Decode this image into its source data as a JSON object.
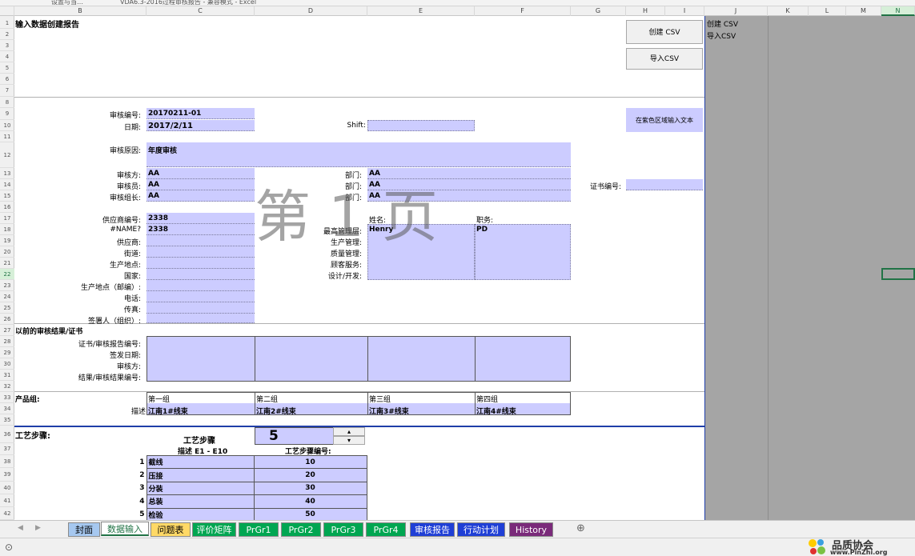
{
  "window": {
    "tab1": "设置与当…",
    "tab2": "VDA6.3-2016过程审核报告 - 兼容模式 - Excel"
  },
  "columns": [
    "B",
    "C",
    "D",
    "E",
    "F",
    "G",
    "H",
    "I",
    "J",
    "K",
    "L",
    "M",
    "N"
  ],
  "rows": [
    "1",
    "2",
    "3",
    "4",
    "5",
    "6",
    "7",
    "8",
    "9",
    "10",
    "11",
    "12",
    "13",
    "14",
    "15",
    "16",
    "17",
    "18",
    "19",
    "20",
    "21",
    "22",
    "23",
    "24",
    "25",
    "26",
    "27",
    "28",
    "29",
    "30",
    "31",
    "32",
    "33",
    "34",
    "35",
    "36",
    "37",
    "38",
    "39",
    "40",
    "41",
    "42"
  ],
  "report": {
    "title": "输入数据创建报告",
    "btn_create_csv": "创建 CSV",
    "btn_import_csv": "导入CSV",
    "note_purple": "在紫色区域输入文本",
    "watermark": "第 1 页"
  },
  "fields": {
    "audit_no_label": "审核编号:",
    "audit_no": "20170211-01",
    "date_label": "日期:",
    "date": "2017/2/11",
    "shift_label": "Shift:",
    "reason_label": "审核原因:",
    "reason": "年度审核",
    "auditee_label": "审核方:",
    "auditee": "AA",
    "auditor_label": "审核员:",
    "auditor": "AA",
    "lead_label": "审核组长:",
    "lead": "AA",
    "dept_label": "部门:",
    "dept1": "AA",
    "dept2": "AA",
    "dept3": "AA",
    "cert_no_label": "证书编号:",
    "supplier_no_label": "供应商编号:",
    "supplier_no": "2338",
    "name_err_label": "#NAME?",
    "name_err_val": "2338",
    "supplier_label": "供应商:",
    "street_label": "街道:",
    "site_label": "生产地点:",
    "country_label": "国家:",
    "postcode_label": "生产地点（邮编）:",
    "phone_label": "电话:",
    "fax_label": "传真:",
    "signer_label": "签署人（组织）:",
    "name_label": "姓名:",
    "position_label": "职务:",
    "mgmt_label": "最高管理层:",
    "mgmt_name": "Henry",
    "mgmt_position": "PD",
    "prod_mgmt_label": "生产管理:",
    "quality_mgmt_label": "质量管理:",
    "customer_service_label": "顾客服务:",
    "design_label": "设计/开发:"
  },
  "previous": {
    "section": "以前的审核结果/证书",
    "cert_report_label": "证书/审核报告编号:",
    "issue_date_label": "签发日期:",
    "auditor_label": "审核方:",
    "result_label": "结果/审核结果编号:"
  },
  "product_groups": {
    "section": "产品组:",
    "desc_label": "描述",
    "groups": [
      {
        "name": "第一组",
        "desc": "江南1#线束"
      },
      {
        "name": "第二组",
        "desc": "江南2#线束"
      },
      {
        "name": "第三组",
        "desc": "江南3#线束"
      },
      {
        "name": "第四组",
        "desc": "江南4#线束"
      }
    ]
  },
  "process_steps": {
    "section": "工艺步骤:",
    "steps_label": "工艺步骤",
    "count": "5",
    "desc_header": "描述 E1 - E10",
    "code_header": "工艺步骤编号:",
    "items": [
      {
        "n": "1",
        "name": "截线",
        "code": "10"
      },
      {
        "n": "2",
        "name": "压接",
        "code": "20"
      },
      {
        "n": "3",
        "name": "分装",
        "code": "30"
      },
      {
        "n": "4",
        "name": "总装",
        "code": "40"
      },
      {
        "n": "5",
        "name": "检验",
        "code": "50"
      }
    ]
  },
  "side_labels": {
    "create_csv": "创建 CSV",
    "import_csv": "导入CSV"
  },
  "tabs": [
    {
      "label": "封面",
      "bg": "#a6c8f0",
      "fg": "#000000"
    },
    {
      "label": "数据输入",
      "bg": "#ffffff",
      "fg": "#217346",
      "active": true
    },
    {
      "label": "问题表",
      "bg": "#ffd966",
      "fg": "#000000"
    },
    {
      "label": "评价矩阵",
      "bg": "#00a651",
      "fg": "#ffffff"
    },
    {
      "label": "PrGr1",
      "bg": "#00a651",
      "fg": "#ffffff"
    },
    {
      "label": "PrGr2",
      "bg": "#00a651",
      "fg": "#ffffff"
    },
    {
      "label": "PrGr3",
      "bg": "#00a651",
      "fg": "#ffffff"
    },
    {
      "label": "PrGr4",
      "bg": "#00a651",
      "fg": "#ffffff"
    },
    {
      "label": "审核报告",
      "bg": "#1f3fd6",
      "fg": "#ffffff"
    },
    {
      "label": "行动计划",
      "bg": "#1f3fd6",
      "fg": "#ffffff"
    },
    {
      "label": "History",
      "bg": "#7a2a7a",
      "fg": "#ffffff"
    }
  ],
  "add_sheet": "⊕",
  "logo": {
    "text": "品质协会",
    "url": "www.PinZhi.org"
  }
}
